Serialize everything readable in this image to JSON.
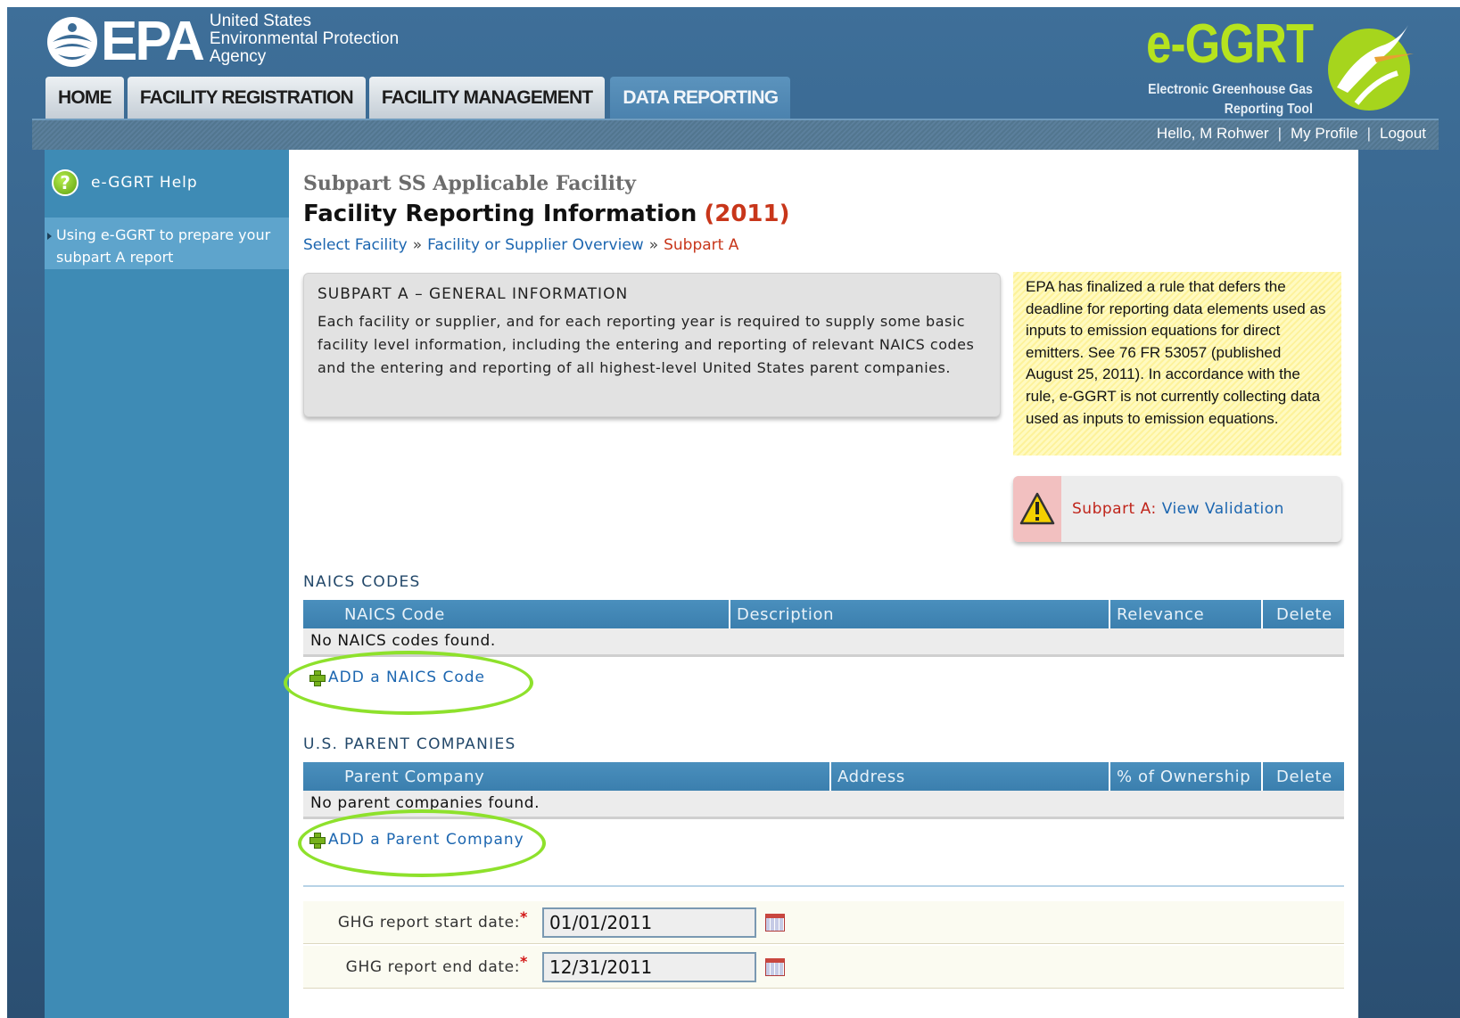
{
  "header": {
    "epa_word": "EPA",
    "epa_agency_lines": [
      "United States",
      "Environmental Protection",
      "Agency"
    ],
    "eggrt_word": "e-GGRT",
    "eggrt_sub_lines": [
      "Electronic Greenhouse Gas",
      "Reporting Tool"
    ]
  },
  "tabs": [
    {
      "label": "HOME"
    },
    {
      "label": "FACILITY REGISTRATION"
    },
    {
      "label": "FACILITY MANAGEMENT"
    },
    {
      "label": "DATA REPORTING",
      "active": true
    }
  ],
  "userbar": {
    "greeting": "Hello, M Rohwer",
    "profile": "My Profile",
    "logout": "Logout",
    "separator": "|"
  },
  "sidebar": {
    "help_label": "e-GGRT Help",
    "help_icon": "question-icon",
    "link_text": "Using e-GGRT to prepare your subpart A report"
  },
  "main": {
    "subtitle": "Subpart SS Applicable Facility",
    "title": "Facility Reporting Information",
    "year": "(2011)",
    "breadcrumb": {
      "items": [
        "Select Facility",
        "Facility or Supplier Overview"
      ],
      "separator": "»",
      "current": "Subpart A"
    },
    "info_box": {
      "title": "SUBPART A – GENERAL INFORMATION",
      "text": "Each facility or supplier, and for each reporting year is required to supply some basic facility level information, including the entering and reporting of relevant NAICS codes and the entering and reporting of all highest-level United States parent companies."
    },
    "notice": "EPA has finalized a rule that defers the deadline for reporting data elements used as inputs to emission equations for direct emitters. See 76 FR 53057 (published August 25, 2011). In accordance with the rule, e-GGRT is not currently collecting data used as inputs to emission equations.",
    "validation": {
      "label": "Subpart A:",
      "link": "View Validation",
      "icon": "warning-icon"
    },
    "naics": {
      "section_title": "NAICS CODES",
      "columns": [
        "NAICS Code",
        "Description",
        "Relevance",
        "Delete"
      ],
      "empty_text": "No NAICS codes found.",
      "add_label": "ADD a NAICS Code"
    },
    "parents": {
      "section_title": "U.S. PARENT COMPANIES",
      "columns": [
        "Parent Company",
        "Address",
        "% of Ownership",
        "Delete"
      ],
      "empty_text": "No parent companies found.",
      "add_label": "ADD a Parent Company"
    },
    "dates": {
      "start_label": "GHG report start date:",
      "start_value": "01/01/2011",
      "end_label": "GHG report end date:",
      "end_value": "12/31/2011",
      "required_mark": "*"
    }
  },
  "colors": {
    "accent_link": "#1c66b0",
    "year_red": "#c8361a",
    "highlight_green": "#8ee12c",
    "logo_green": "#b6e31e"
  }
}
